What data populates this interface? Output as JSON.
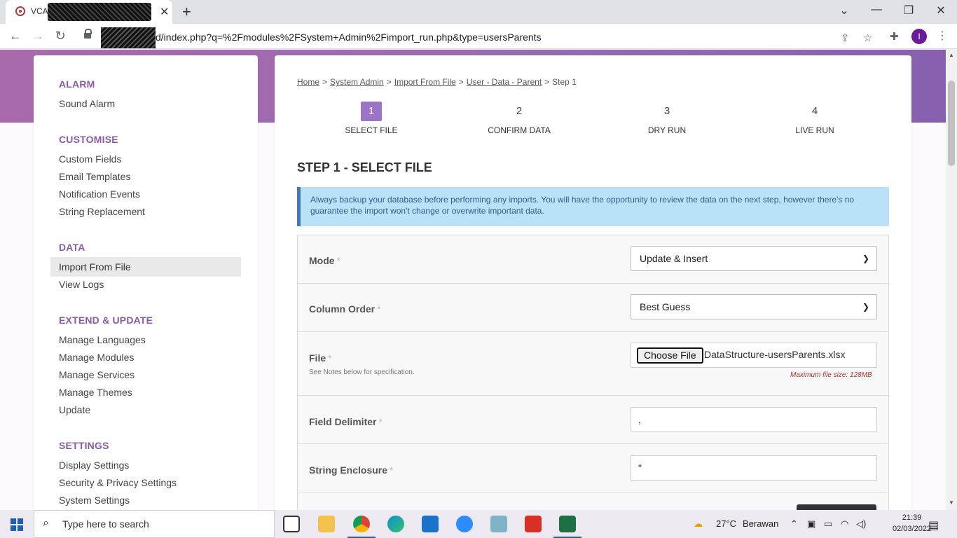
{
  "browser": {
    "tab_title": "VCA",
    "url": "d/index.php?q=%2Fmodules%2FSystem+Admin%2Fimport_run.php&type=usersParents",
    "profile_initial": "I"
  },
  "sidebar": {
    "sections": [
      {
        "heading": "ALARM",
        "items": [
          "Sound Alarm"
        ]
      },
      {
        "heading": "CUSTOMISE",
        "items": [
          "Custom Fields",
          "Email Templates",
          "Notification Events",
          "String Replacement"
        ]
      },
      {
        "heading": "DATA",
        "items": [
          "Import From File",
          "View Logs"
        ]
      },
      {
        "heading": "EXTEND & UPDATE",
        "items": [
          "Manage Languages",
          "Manage Modules",
          "Manage Services",
          "Manage Themes",
          "Update"
        ]
      },
      {
        "heading": "SETTINGS",
        "items": [
          "Display Settings",
          "Security & Privacy Settings",
          "System Settings"
        ]
      }
    ],
    "active_item": "Import From File"
  },
  "breadcrumb": {
    "items": [
      "Home",
      "System Admin",
      "Import From File",
      "User - Data - Parent"
    ],
    "current": "Step 1",
    "separator": ">"
  },
  "steps": [
    {
      "num": "1",
      "label": "SELECT FILE",
      "current": true
    },
    {
      "num": "2",
      "label": "CONFIRM DATA",
      "current": false
    },
    {
      "num": "3",
      "label": "DRY RUN",
      "current": false
    },
    {
      "num": "4",
      "label": "LIVE RUN",
      "current": false
    }
  ],
  "heading": "STEP 1 - SELECT FILE",
  "notice": "Always backup your database before performing any imports. You will have the opportunity to review the data on the next step, however there's no guarantee the import won't change or overwrite important data.",
  "form": {
    "required_mark": "*",
    "mode": {
      "label": "Mode",
      "value": "Update & Insert"
    },
    "column_order": {
      "label": "Column Order",
      "value": "Best Guess"
    },
    "file": {
      "label": "File",
      "sub": "See Notes below for specification.",
      "button": "Choose File",
      "filename": "DataStructure-usersParents.xlsx",
      "max_note": "Maximum file size: 128MB"
    },
    "field_delimiter": {
      "label": "Field Delimiter",
      "value": ","
    },
    "string_enclosure": {
      "label": "String Enclosure",
      "value": "\""
    }
  },
  "taskbar": {
    "search_placeholder": "Type here to search",
    "weather_temp": "27°C",
    "weather_desc": "Berawan",
    "time": "21:39",
    "date": "02/03/2022"
  },
  "colors": {
    "accent_purple": "#8a5aa8",
    "step_active": "#9c73c7",
    "notice_bg": "#b9e1f7",
    "notice_border": "#3f79b8"
  }
}
